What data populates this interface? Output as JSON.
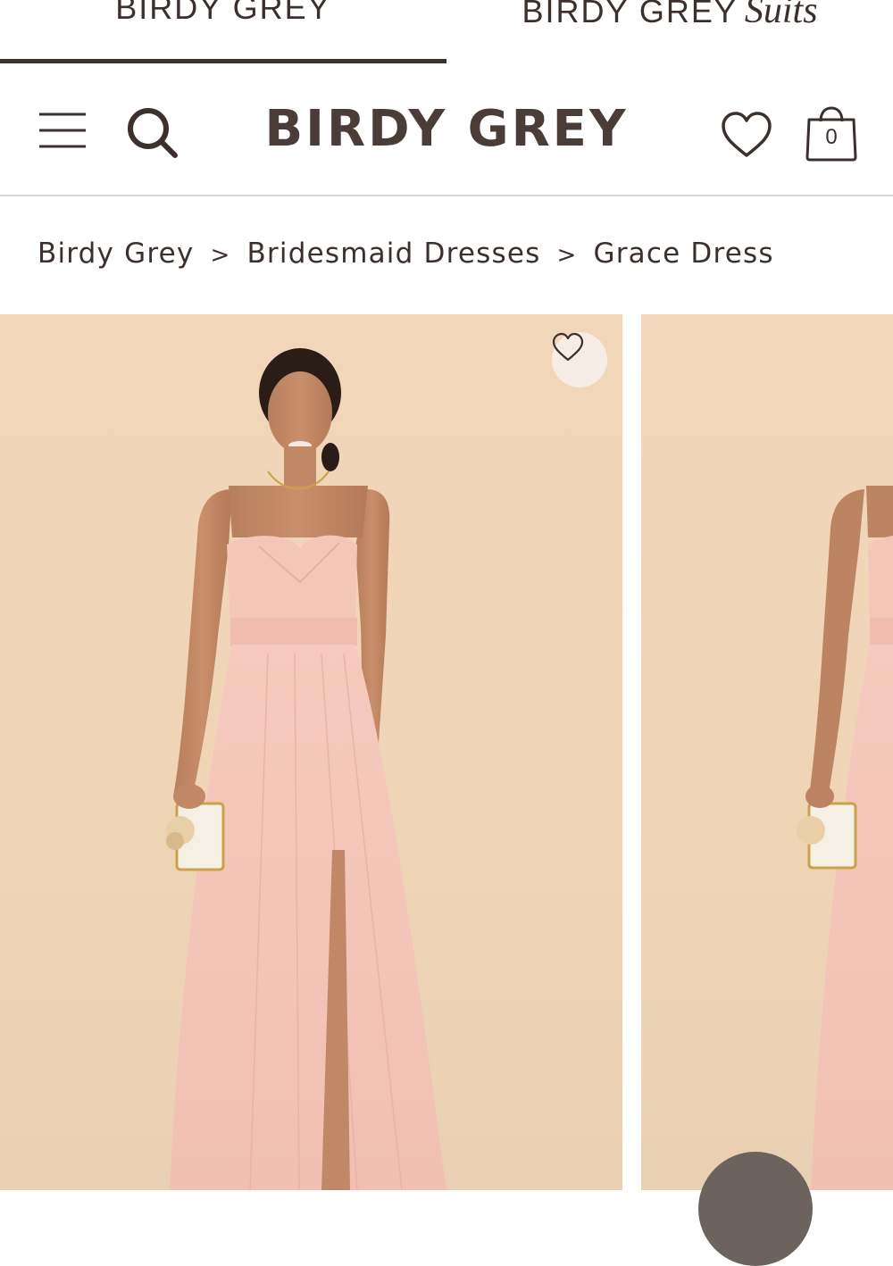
{
  "brand_tabs": [
    {
      "label": "BIRDY GREY",
      "suffix": "",
      "active": true
    },
    {
      "label": "BIRDY GREY",
      "suffix": "Suits",
      "active": false
    }
  ],
  "header": {
    "logo": "BIRDY GREY",
    "cart_count": "0",
    "icons": [
      "menu-icon",
      "search-icon",
      "heart-icon",
      "shopping-bag-icon"
    ]
  },
  "breadcrumb": {
    "items": [
      "Birdy Grey",
      "Bridesmaid Dresses",
      "Grace Dress"
    ],
    "separator": ">"
  },
  "gallery": {
    "favorite_icon": "heart-icon"
  },
  "colors": {
    "brand_text": "#3b302c",
    "photo_background": "#f0d4b6",
    "dress": "#f3c2b6",
    "favorite_bg": "#f6eee6"
  }
}
